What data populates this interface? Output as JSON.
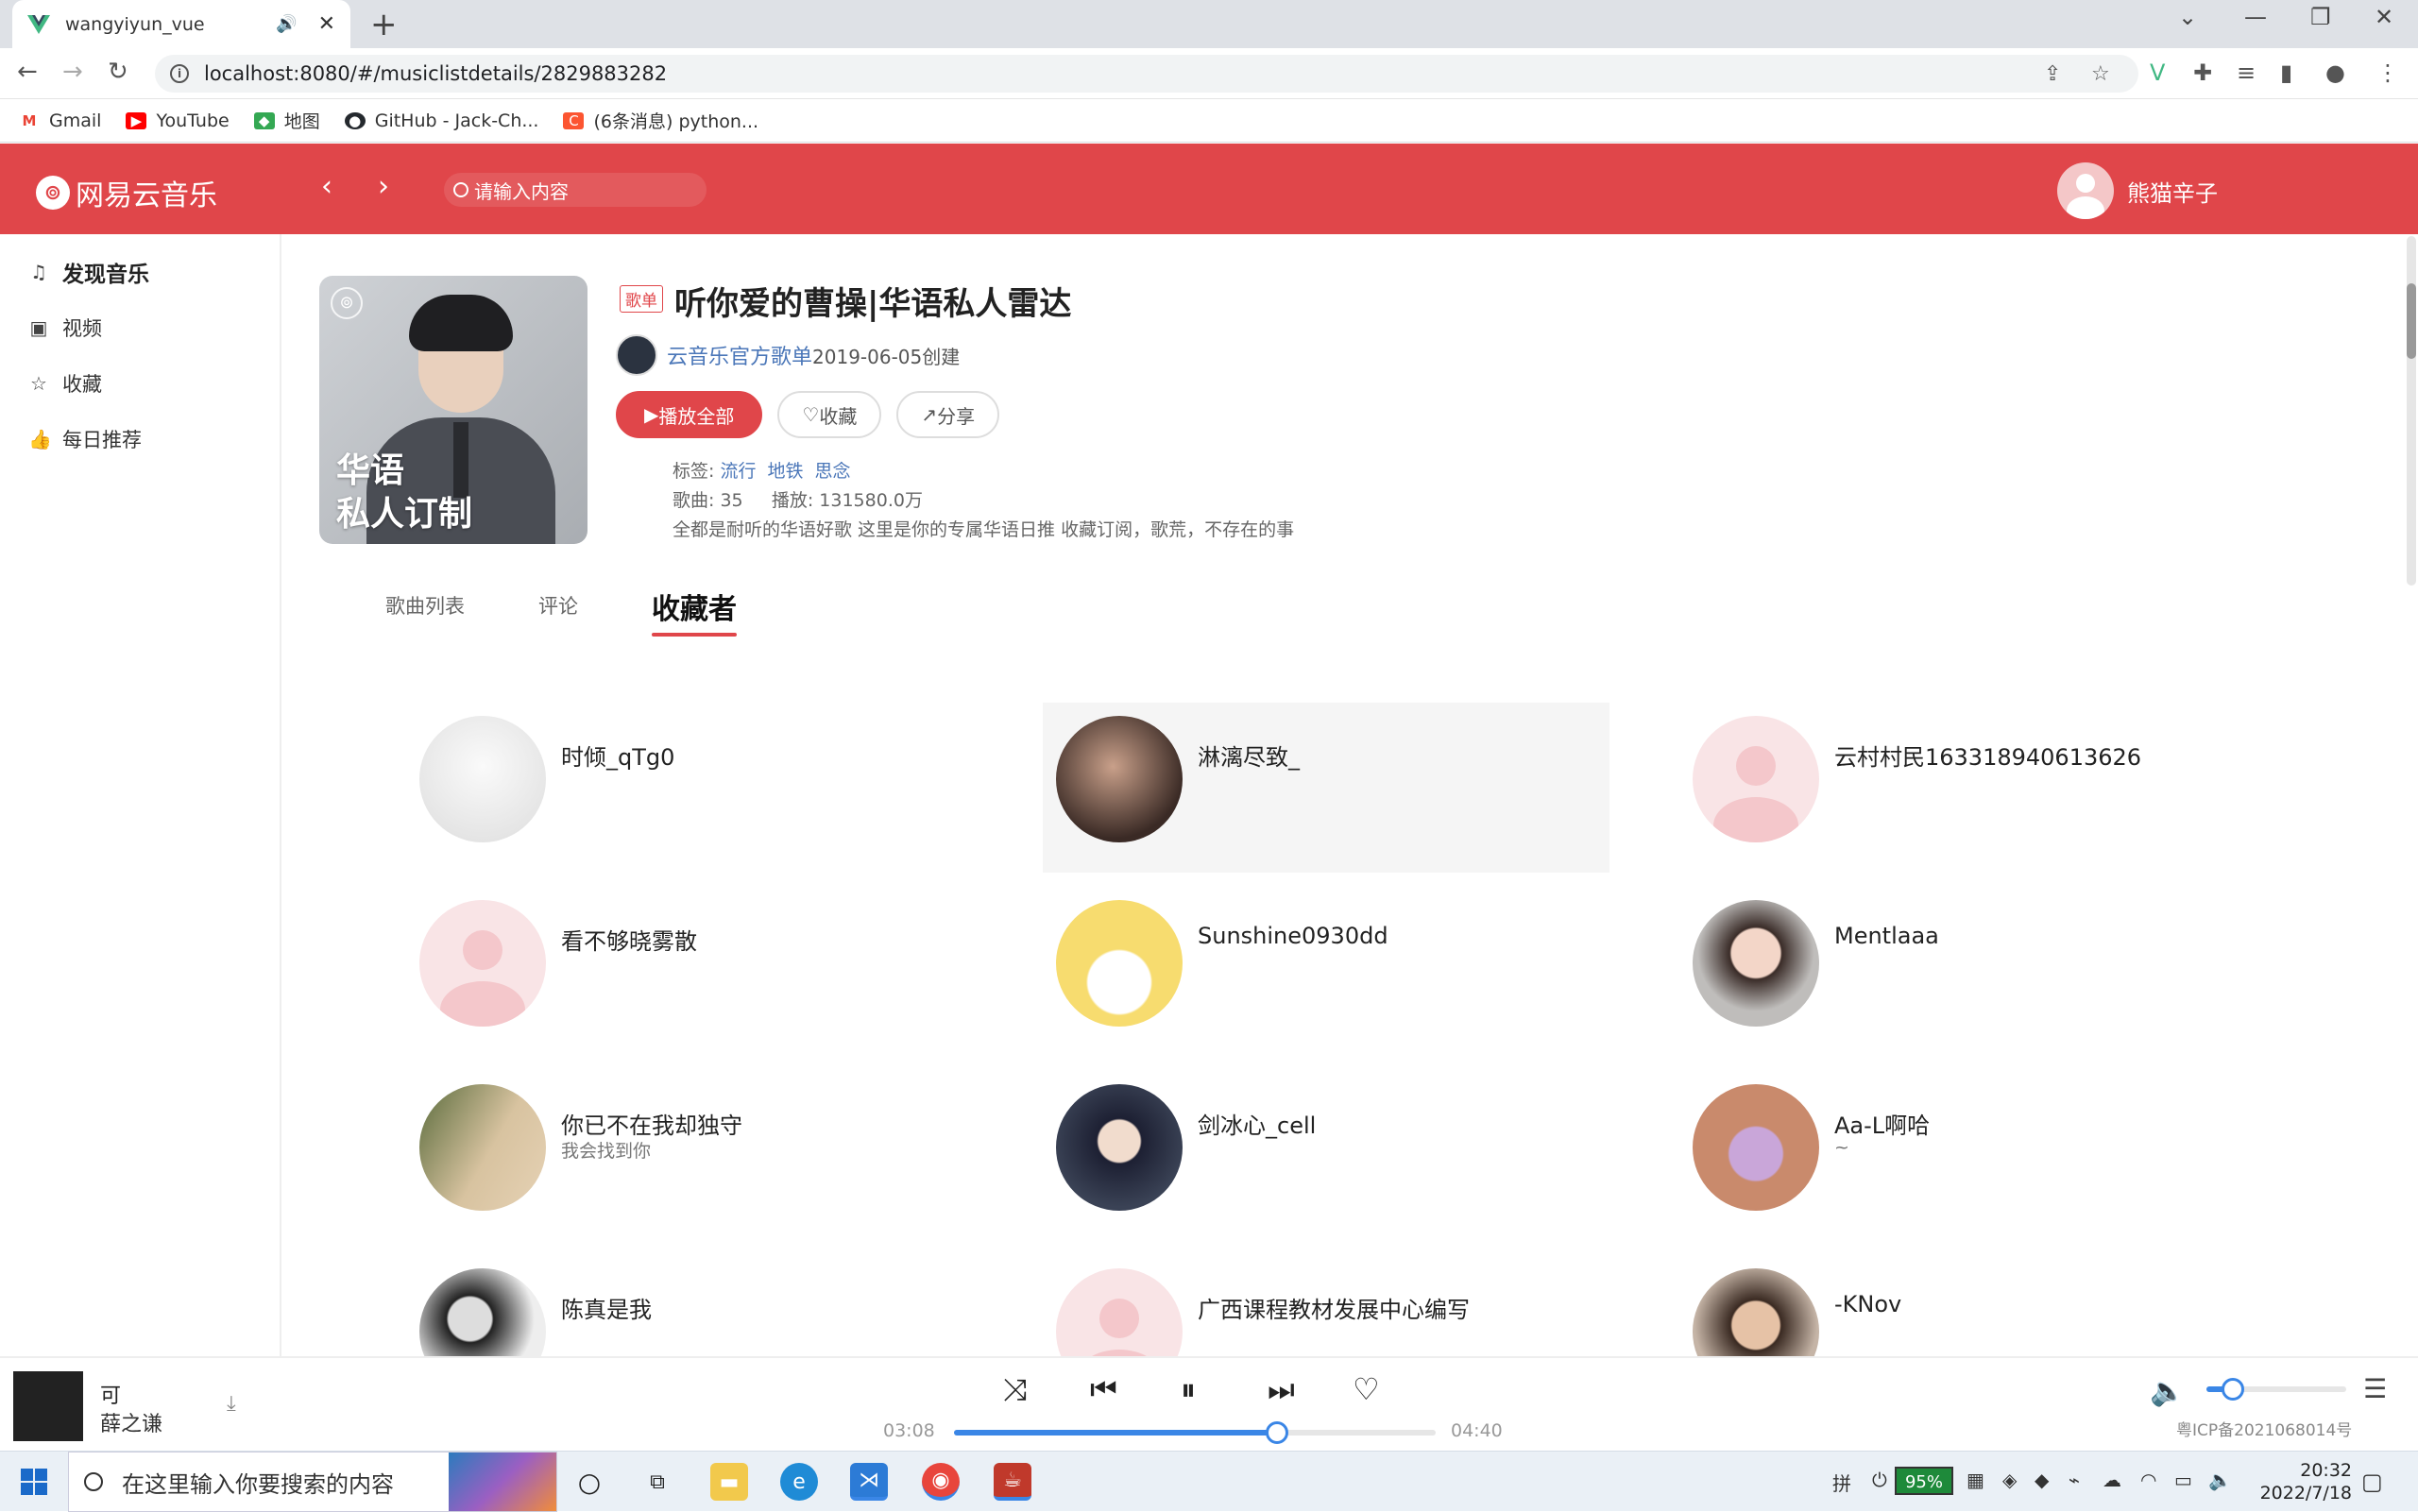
{
  "browser": {
    "tab_title": "wangyiyun_vue",
    "url": "localhost:8080/#/musiclistdetails/2829883282",
    "bookmarks": [
      {
        "label": "Gmail",
        "color": "#ea4335",
        "icon": "gmail-icon"
      },
      {
        "label": "YouTube",
        "color": "#ff0000",
        "icon": "youtube-icon"
      },
      {
        "label": "地图",
        "color": "#34a853",
        "icon": "maps-icon"
      },
      {
        "label": "GitHub - Jack-Ch...",
        "color": "#24292e",
        "icon": "github-icon"
      },
      {
        "label": "(6条消息) python...",
        "color": "#fc5531",
        "icon": "csdn-icon"
      }
    ]
  },
  "app": {
    "brand": "网易云音乐",
    "search_placeholder": "请输入内容",
    "username": "熊猫辛子",
    "accent": "#e0464a"
  },
  "sidebar": {
    "items": [
      {
        "label": "发现音乐",
        "icon": "music-note-icon"
      },
      {
        "label": "视频",
        "icon": "video-icon"
      },
      {
        "label": "收藏",
        "icon": "star-icon"
      },
      {
        "label": "每日推荐",
        "icon": "thumbs-up-icon"
      }
    ]
  },
  "playlist": {
    "cover_text_1": "华语",
    "cover_text_2": "私人订制",
    "badge": "歌单",
    "title": "听你爱的曹操|华语私人雷达",
    "creator": "云音乐官方歌单",
    "created": "2019-06-05创建",
    "play_all": "播放全部",
    "collect": "收藏",
    "share": "分享",
    "tags_label": "标签:",
    "tags": [
      "流行",
      "地铁",
      "思念"
    ],
    "songs_label": "歌曲:",
    "songs_count": "35",
    "plays_label": "播放:",
    "plays_count": "131580.0万",
    "description": "全都是耐听的华语好歌 这里是你的专属华语日推 收藏订阅，歌荒，不存在的事"
  },
  "tabs": [
    "歌曲列表",
    "评论",
    "收藏者"
  ],
  "active_tab": "收藏者",
  "subscribers": [
    {
      "name": "时倾_qTg0",
      "signature": ""
    },
    {
      "name": "淋漓尽致_",
      "signature": ""
    },
    {
      "name": "云村村民163318940613626",
      "signature": ""
    },
    {
      "name": "看不够晓雾散",
      "signature": ""
    },
    {
      "name": "Sunshine0930dd",
      "signature": ""
    },
    {
      "name": "Mentlaaa",
      "signature": ""
    },
    {
      "name": "你已不在我却独守",
      "signature": "我会找到你"
    },
    {
      "name": "剑冰心_cell",
      "signature": ""
    },
    {
      "name": "Aa-L啊哈",
      "signature": "~"
    },
    {
      "name": "陈真是我",
      "signature": ""
    },
    {
      "name": "广西课程教材发展中心编写",
      "signature": ""
    },
    {
      "name": "-KNov",
      "signature": ""
    }
  ],
  "player": {
    "song": "可",
    "artist": "薛之谦",
    "current_time": "03:08",
    "total_time": "04:40",
    "progress_percent": 67,
    "volume_percent": 19,
    "icp": "粤ICP备2021068014号"
  },
  "taskbar": {
    "search_placeholder": "在这里输入你要搜索的内容",
    "battery": "95%",
    "time": "20:32",
    "date": "2022/7/18",
    "ime": "拼"
  }
}
